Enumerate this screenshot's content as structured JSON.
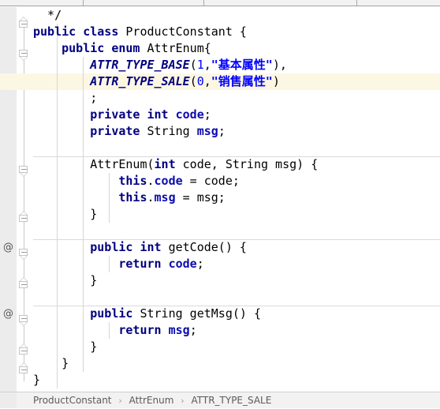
{
  "window": {
    "app": "IntelliJ IDEA",
    "view": "java-code-editor"
  },
  "top_strip": {
    "divider_positions": [
      105,
      258,
      452
    ]
  },
  "editor": {
    "language": "Java",
    "file": "ProductConstant.java",
    "highlighted_line_number": 5,
    "colors": {
      "background": "#ffffff",
      "gutter": "#ececec",
      "caret_row": "#fcf7e3",
      "keyword": "#000080",
      "enum_constant": "#000080",
      "field": "#0b0bb0",
      "number": "#0000ff",
      "string": "#0000ff",
      "plain": "#000000",
      "separator": "#dadada",
      "indent_guide": "#d6d6d6"
    },
    "gutter_marks": [
      {
        "line": 14,
        "glyph": "@",
        "name": "override-marker"
      },
      {
        "line": 18,
        "glyph": "@",
        "name": "override-marker"
      }
    ],
    "fold_handles": [
      {
        "line": 1,
        "type": "collapse-end"
      },
      {
        "line": 3,
        "type": "collapse-start"
      },
      {
        "line": 10,
        "type": "collapse-start"
      },
      {
        "line": 13,
        "type": "collapse-end"
      },
      {
        "line": 14,
        "type": "collapse-start"
      },
      {
        "line": 16,
        "type": "collapse-end"
      },
      {
        "line": 18,
        "type": "collapse-start"
      },
      {
        "line": 20,
        "type": "collapse-end"
      },
      {
        "line": 21,
        "type": "collapse-end"
      }
    ],
    "lines": [
      {
        "n": 1,
        "text": "  */"
      },
      {
        "n": 2,
        "text": "public class ProductConstant {"
      },
      {
        "n": 3,
        "text": "    public enum AttrEnum{"
      },
      {
        "n": 4,
        "text": "        ATTR_TYPE_BASE(1,\"基本属性\"),"
      },
      {
        "n": 5,
        "text": "        ATTR_TYPE_SALE(0,\"销售属性\")"
      },
      {
        "n": 6,
        "text": "        ;"
      },
      {
        "n": 7,
        "text": "        private int code;"
      },
      {
        "n": 8,
        "text": "        private String msg;"
      },
      {
        "n": 9,
        "text": ""
      },
      {
        "n": 10,
        "text": "        AttrEnum(int code, String msg) {"
      },
      {
        "n": 11,
        "text": "            this.code = code;"
      },
      {
        "n": 12,
        "text": "            this.msg = msg;"
      },
      {
        "n": 13,
        "text": "        }"
      },
      {
        "n": 14,
        "text": ""
      },
      {
        "n": 15,
        "text": "        public int getCode() {"
      },
      {
        "n": 16,
        "text": "            return code;"
      },
      {
        "n": 17,
        "text": "        }"
      },
      {
        "n": 18,
        "text": ""
      },
      {
        "n": 19,
        "text": "        public String getMsg() {"
      },
      {
        "n": 20,
        "text": "            return msg;"
      },
      {
        "n": 21,
        "text": "        }"
      },
      {
        "n": 22,
        "text": "    }"
      },
      {
        "n": 23,
        "text": "}"
      }
    ]
  },
  "breadcrumb": {
    "separator": "›",
    "items": [
      {
        "label": "ProductConstant"
      },
      {
        "label": "AttrEnum"
      },
      {
        "label": "ATTR_TYPE_SALE"
      }
    ]
  }
}
